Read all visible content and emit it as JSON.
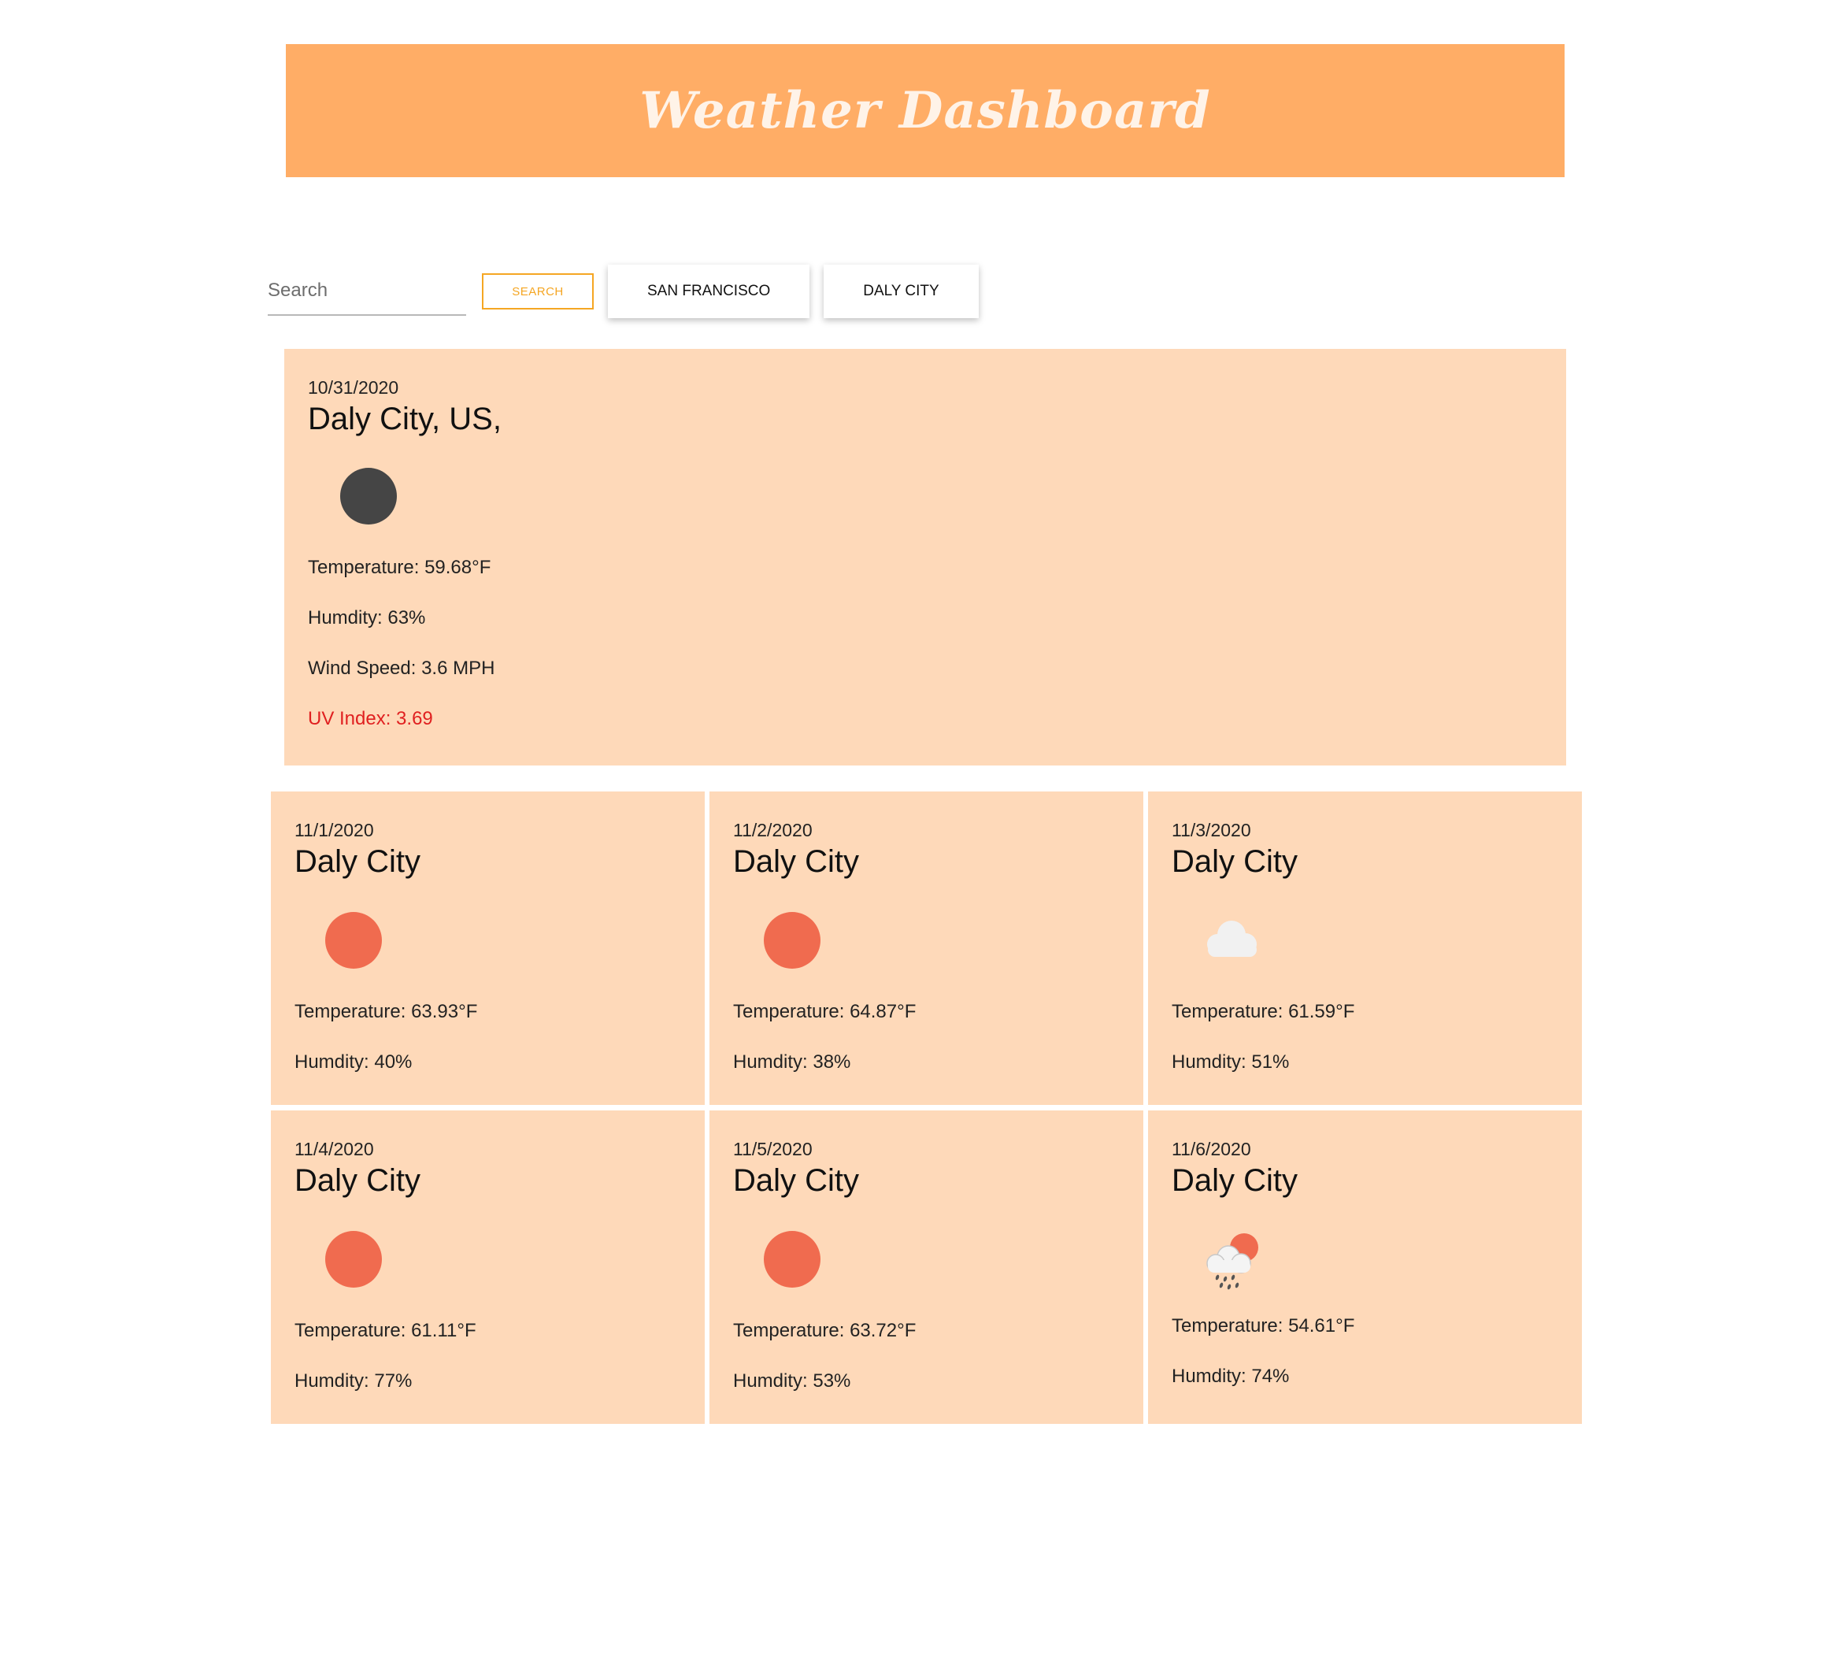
{
  "header": {
    "title": "Weather Dashboard"
  },
  "search": {
    "placeholder": "Search",
    "button_label": "SEARCH"
  },
  "history": [
    {
      "label": "SAN FRANCISCO"
    },
    {
      "label": "DALY CITY"
    }
  ],
  "current": {
    "date": "10/31/2020",
    "city": "Daly City, US,",
    "icon": "moon-clear-night-icon",
    "temperature": "Temperature: 59.68°F",
    "humidity": "Humdity: 63%",
    "wind": "Wind Speed: 3.6 MPH",
    "uv": "UV Index: 3.69"
  },
  "forecast": [
    {
      "date": "11/1/2020",
      "city": "Daly City",
      "icon": "sun-icon",
      "temperature": "Temperature: 63.93°F",
      "humidity": "Humdity: 40%"
    },
    {
      "date": "11/2/2020",
      "city": "Daly City",
      "icon": "sun-icon",
      "temperature": "Temperature: 64.87°F",
      "humidity": "Humdity: 38%"
    },
    {
      "date": "11/3/2020",
      "city": "Daly City",
      "icon": "cloud-icon",
      "temperature": "Temperature: 61.59°F",
      "humidity": "Humdity: 51%"
    },
    {
      "date": "11/4/2020",
      "city": "Daly City",
      "icon": "sun-icon",
      "temperature": "Temperature: 61.11°F",
      "humidity": "Humdity: 77%"
    },
    {
      "date": "11/5/2020",
      "city": "Daly City",
      "icon": "sun-icon",
      "temperature": "Temperature: 63.72°F",
      "humidity": "Humdity: 53%"
    },
    {
      "date": "11/6/2020",
      "city": "Daly City",
      "icon": "rain-sun-icon",
      "temperature": "Temperature: 54.61°F",
      "humidity": "Humdity: 74%"
    }
  ],
  "colors": {
    "header_bg": "#ffad66",
    "card_bg": "#fed9b9",
    "accent": "#f5a623",
    "uv_text": "#e02020",
    "sun": "#f06b4f",
    "moon": "#454545",
    "cloud": "#f1f1f1"
  }
}
